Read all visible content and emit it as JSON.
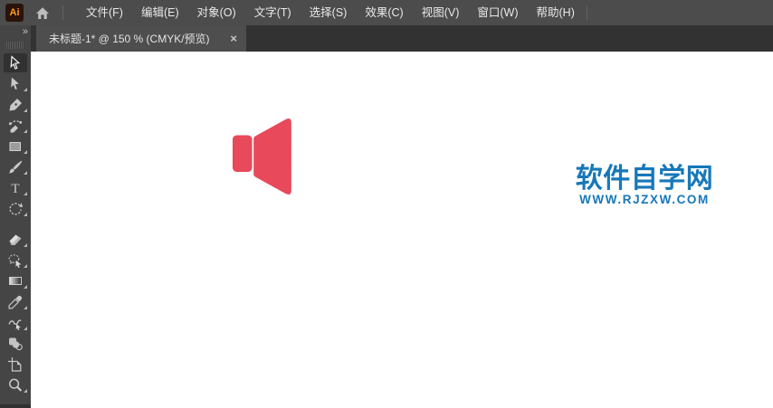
{
  "app_badge": {
    "label": "Ai"
  },
  "menubar": {
    "items": [
      {
        "label": "文件(F)"
      },
      {
        "label": "编辑(E)"
      },
      {
        "label": "对象(O)"
      },
      {
        "label": "文字(T)"
      },
      {
        "label": "选择(S)"
      },
      {
        "label": "效果(C)"
      },
      {
        "label": "视图(V)"
      },
      {
        "label": "窗口(W)"
      },
      {
        "label": "帮助(H)"
      }
    ]
  },
  "document_tab": {
    "title": "未标题-1* @ 150 % (CMYK/预览)",
    "close_glyph": "×"
  },
  "toolbar": {
    "collapse_glyph": "»",
    "tools": [
      "selection",
      "direct-selection",
      "pen",
      "curvature",
      "rectangle",
      "paintbrush",
      "type",
      "rotate",
      "eraser",
      "lasso-bubble",
      "gradient",
      "eyedropper",
      "shaper",
      "blend",
      "artboard",
      "zoom"
    ],
    "active_tool": "selection"
  },
  "canvas": {
    "speaker": {
      "color": "#E8495B"
    },
    "watermark": {
      "title": "软件自学网",
      "url": "WWW.RJZXW.COM",
      "color": "#1778B9"
    }
  },
  "colors": {
    "menubar_bg": "#4C4C4C",
    "tabstrip_bg": "#323232",
    "tab_bg": "#4E4E4E",
    "dock_bg": "#454545",
    "canvas_bg": "#FFFFFF",
    "ai_badge_bg": "#2A130B",
    "ai_badge_fg": "#FF9C1A",
    "icon_grey": "#C9C9C9"
  }
}
